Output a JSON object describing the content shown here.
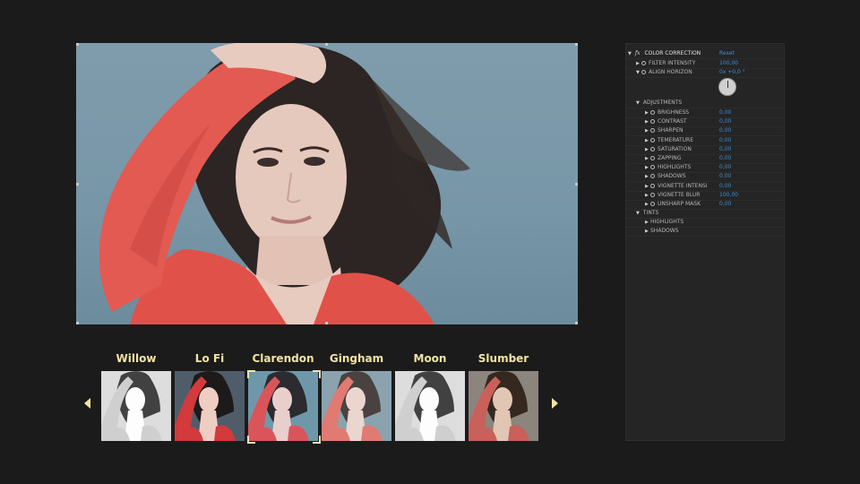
{
  "filters": [
    {
      "name": "Willow",
      "tone": "bw"
    },
    {
      "name": "Lo Fi",
      "tone": "vivid"
    },
    {
      "name": "Clarendon",
      "tone": "cool",
      "selected": true
    },
    {
      "name": "Gingham",
      "tone": "faded"
    },
    {
      "name": "Moon",
      "tone": "bw"
    },
    {
      "name": "Slumber",
      "tone": "warm"
    }
  ],
  "panel": {
    "effect_label": "COLOR CORRECTION",
    "fx_symbol": "fx",
    "reset_label": "Reset",
    "top_params": [
      {
        "label": "FILTER INTENSITY",
        "value": "100,00"
      },
      {
        "label": "ALIGN HORIZON",
        "value": "0x +0,0 °"
      }
    ],
    "adjustments_label": "ADJUSTMENTS",
    "adjustments": [
      {
        "label": "BRIGHNESS",
        "value": "0,00"
      },
      {
        "label": "CONTRAST",
        "value": "0,00"
      },
      {
        "label": "SHARPEN",
        "value": "0,00"
      },
      {
        "label": "TEMERATURE",
        "value": "0,00"
      },
      {
        "label": "SATURATION",
        "value": "0,00"
      },
      {
        "label": "ZAPPING",
        "value": "0,00"
      },
      {
        "label": "HIGHLIGHTS",
        "value": "0,00"
      },
      {
        "label": "SHADOWS",
        "value": "0,00"
      },
      {
        "label": "VIGNETTE INTENSI",
        "value": "0,00"
      },
      {
        "label": "VIGNETTE BLUR",
        "value": "100,00"
      },
      {
        "label": "UNSHARP MASK",
        "value": "0,00"
      }
    ],
    "tints_label": "TINTS",
    "tints": [
      {
        "label": "HIGHLIGHTS"
      },
      {
        "label": "SHADOWS"
      }
    ]
  },
  "colors": {
    "accent_value": "#3d8fd6",
    "filter_label": "#f1e3a6",
    "panel_bg": "#252525",
    "shirt": "#e0514a",
    "backdrop": "#7f9cac"
  },
  "icons": {
    "prev": "chevron-left-icon",
    "next": "chevron-right-icon",
    "stopwatch": "stopwatch-icon",
    "expand": "triangle-right-icon",
    "collapse": "triangle-down-icon"
  }
}
